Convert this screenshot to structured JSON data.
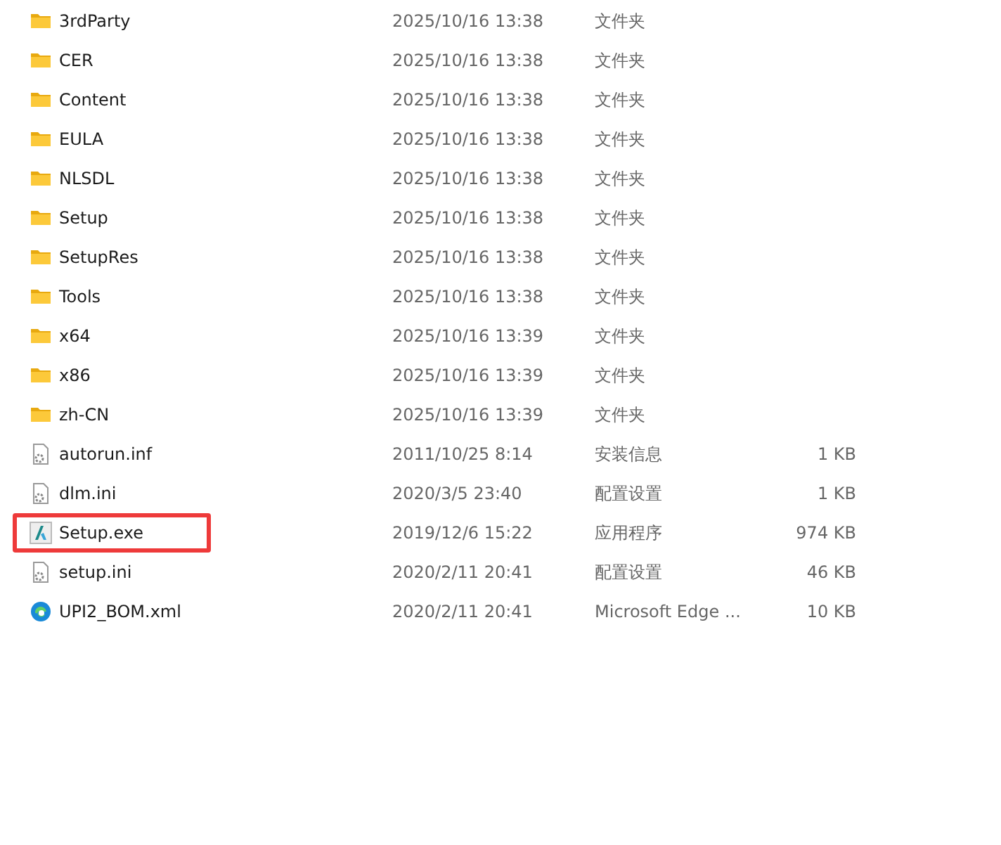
{
  "files": [
    {
      "kind": "folder",
      "name": "3rdParty",
      "date": "2025/10/16 13:38",
      "type": "文件夹",
      "highlighted": false
    },
    {
      "kind": "folder",
      "name": "CER",
      "date": "2025/10/16 13:38",
      "type": "文件夹",
      "highlighted": false
    },
    {
      "kind": "folder",
      "name": "Content",
      "date": "2025/10/16 13:38",
      "type": "文件夹",
      "highlighted": false
    },
    {
      "kind": "folder",
      "name": "EULA",
      "date": "2025/10/16 13:38",
      "type": "文件夹",
      "highlighted": false
    },
    {
      "kind": "folder",
      "name": "NLSDL",
      "date": "2025/10/16 13:38",
      "type": "文件夹",
      "highlighted": false
    },
    {
      "kind": "folder",
      "name": "Setup",
      "date": "2025/10/16 13:38",
      "type": "文件夹",
      "highlighted": false
    },
    {
      "kind": "folder",
      "name": "SetupRes",
      "date": "2025/10/16 13:38",
      "type": "文件夹",
      "highlighted": false
    },
    {
      "kind": "folder",
      "name": "Tools",
      "date": "2025/10/16 13:38",
      "type": "文件夹",
      "highlighted": false
    },
    {
      "kind": "folder",
      "name": "x64",
      "date": "2025/10/16 13:39",
      "type": "文件夹",
      "highlighted": false
    },
    {
      "kind": "folder",
      "name": "x86",
      "date": "2025/10/16 13:39",
      "type": "文件夹",
      "highlighted": false
    },
    {
      "kind": "folder",
      "name": "zh-CN",
      "date": "2025/10/16 13:39",
      "type": "文件夹",
      "highlighted": false
    },
    {
      "kind": "settings",
      "name": "autorun.inf",
      "date": "2011/10/25 8:14",
      "type": "安装信息",
      "size": "1 KB",
      "highlighted": false
    },
    {
      "kind": "settings",
      "name": "dlm.ini",
      "date": "2020/3/5 23:40",
      "type": "配置设置",
      "size": "1 KB",
      "highlighted": false
    },
    {
      "kind": "app",
      "name": "Setup.exe",
      "date": "2019/12/6 15:22",
      "type": "应用程序",
      "size": "974 KB",
      "highlighted": true
    },
    {
      "kind": "settings",
      "name": "setup.ini",
      "date": "2020/2/11 20:41",
      "type": "配置设置",
      "size": "46 KB",
      "highlighted": false
    },
    {
      "kind": "browser",
      "name": "UPI2_BOM.xml",
      "date": "2020/2/11 20:41",
      "type": "Microsoft Edge ...",
      "size": "10 KB",
      "highlighted": false
    }
  ]
}
